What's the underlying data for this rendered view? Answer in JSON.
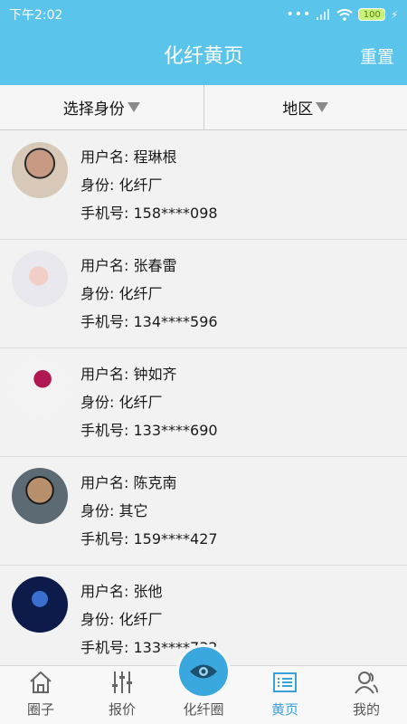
{
  "status": {
    "time": "下午2:02",
    "battery": "100"
  },
  "appbar": {
    "title": "化纤黄页",
    "reset_label": "重置"
  },
  "filters": {
    "identity": "选择身份",
    "region": "地区"
  },
  "labels": {
    "username": "用户名: ",
    "identity": "身份: ",
    "phone": "手机号: "
  },
  "users": [
    {
      "name": "程琳根",
      "identity": "化纤厂",
      "phone": "158****098"
    },
    {
      "name": "张春雷",
      "identity": "化纤厂",
      "phone": "134****596"
    },
    {
      "name": "钟如齐",
      "identity": "化纤厂",
      "phone": "133****690"
    },
    {
      "name": "陈克南",
      "identity": "其它",
      "phone": "159****427"
    },
    {
      "name": "张他",
      "identity": "化纤厂",
      "phone": "133****732"
    }
  ],
  "tabs": [
    {
      "label": "圈子",
      "icon": "home-icon"
    },
    {
      "label": "报价",
      "icon": "sliders-icon"
    },
    {
      "label": "化纤圈",
      "icon": "eye-icon"
    },
    {
      "label": "黄页",
      "icon": "list-icon"
    },
    {
      "label": "我的",
      "icon": "user-icon"
    }
  ],
  "active_tab": "黄页",
  "colors": {
    "primary": "#5bc4ea",
    "active": "#3aa0d8"
  }
}
